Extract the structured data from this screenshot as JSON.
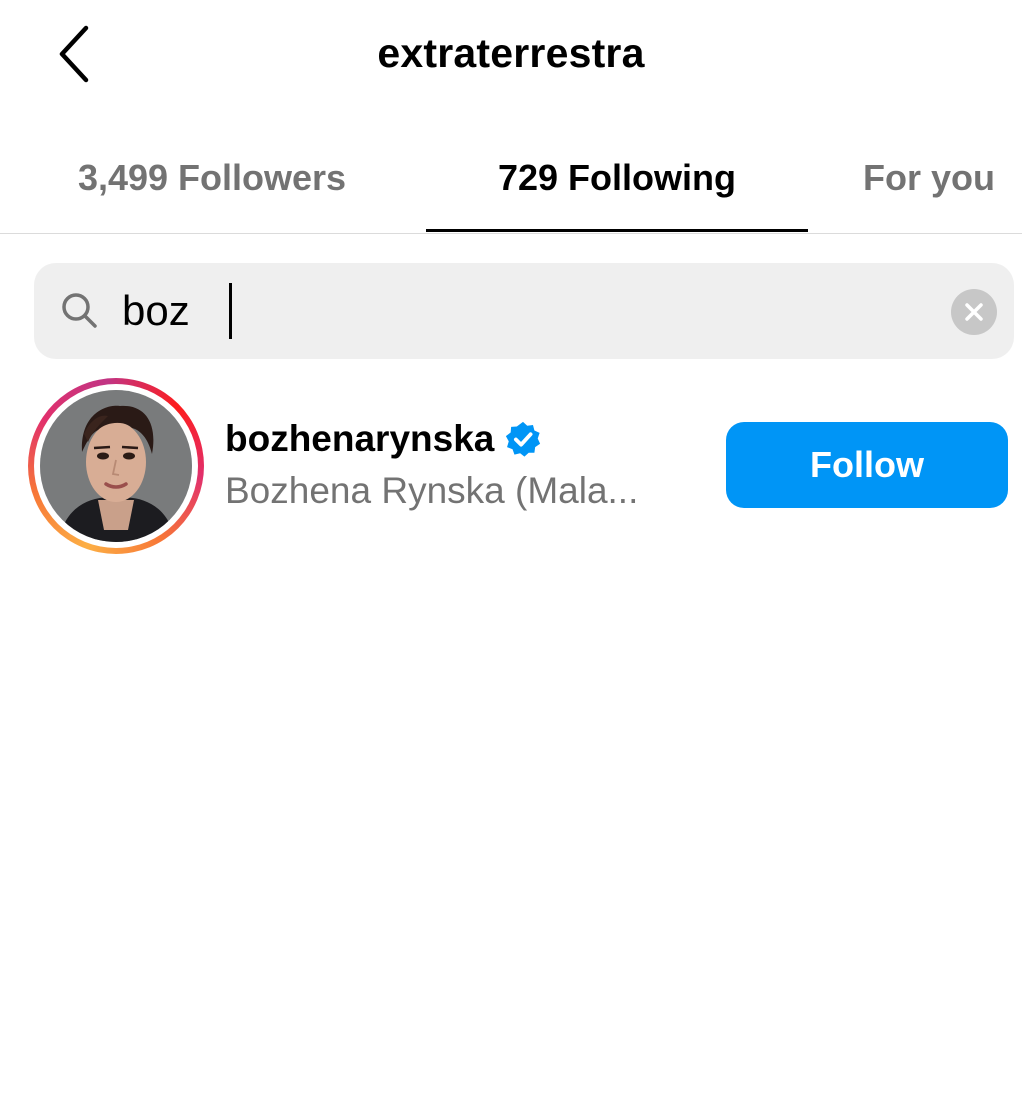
{
  "header": {
    "title": "extraterrestra",
    "back_icon": "chevron-left-icon"
  },
  "tabs": [
    {
      "label": "3,499 Followers",
      "active": false
    },
    {
      "label": "729 Following",
      "active": true
    },
    {
      "label": "For you",
      "active": false
    }
  ],
  "search": {
    "value": "boz",
    "icon": "search-icon",
    "clear_icon": "clear-icon"
  },
  "results": [
    {
      "username": "bozhenarynska",
      "verified": true,
      "full_name": "Bozhena Rynska (Mala...",
      "button_label": "Follow"
    }
  ],
  "colors": {
    "accent": "#0095f6",
    "verified": "#0095f6",
    "secondary_text": "#737373",
    "search_bg": "#efefef"
  }
}
